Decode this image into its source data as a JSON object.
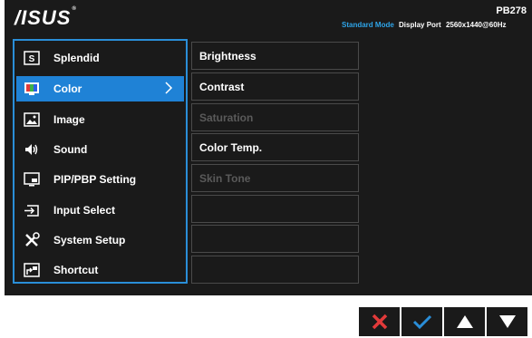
{
  "brand": {
    "logo_text": "/ISUS",
    "trademark": "®"
  },
  "header": {
    "model": "PB278",
    "status": {
      "mode_name": "Standard",
      "mode_label": "Mode",
      "input": "Display Port",
      "resolution": "2560x1440@60Hz"
    }
  },
  "main_menu": {
    "items": [
      {
        "label": "Splendid",
        "icon": "splendid-icon",
        "selected": false
      },
      {
        "label": "Color",
        "icon": "color-icon",
        "selected": true
      },
      {
        "label": "Image",
        "icon": "image-icon",
        "selected": false
      },
      {
        "label": "Sound",
        "icon": "speaker-icon",
        "selected": false
      },
      {
        "label": "PIP/PBP Setting",
        "icon": "pip-icon",
        "selected": false
      },
      {
        "label": "Input Select",
        "icon": "input-select-icon",
        "selected": false
      },
      {
        "label": "System Setup",
        "icon": "wrench-screwdriver-icon",
        "selected": false
      },
      {
        "label": "Shortcut",
        "icon": "shortcut-icon",
        "selected": false
      }
    ]
  },
  "sub_menu": {
    "items": [
      {
        "label": "Brightness",
        "enabled": true
      },
      {
        "label": "Contrast",
        "enabled": true
      },
      {
        "label": "Saturation",
        "enabled": false
      },
      {
        "label": "Color Temp.",
        "enabled": true
      },
      {
        "label": "Skin Tone",
        "enabled": false
      },
      {
        "label": "",
        "enabled": false
      },
      {
        "label": "",
        "enabled": false
      },
      {
        "label": "",
        "enabled": false
      }
    ]
  },
  "nav_buttons": [
    {
      "icon": "close-icon",
      "color": "#e23a3a"
    },
    {
      "icon": "checkmark-icon",
      "color": "#2a8ed8"
    },
    {
      "icon": "arrow-up-icon",
      "color": "#ffffff"
    },
    {
      "icon": "arrow-down-icon",
      "color": "#ffffff"
    }
  ],
  "colors": {
    "accent": "#1f82d6",
    "background": "#1a1a1a",
    "cancel": "#e23a3a"
  }
}
